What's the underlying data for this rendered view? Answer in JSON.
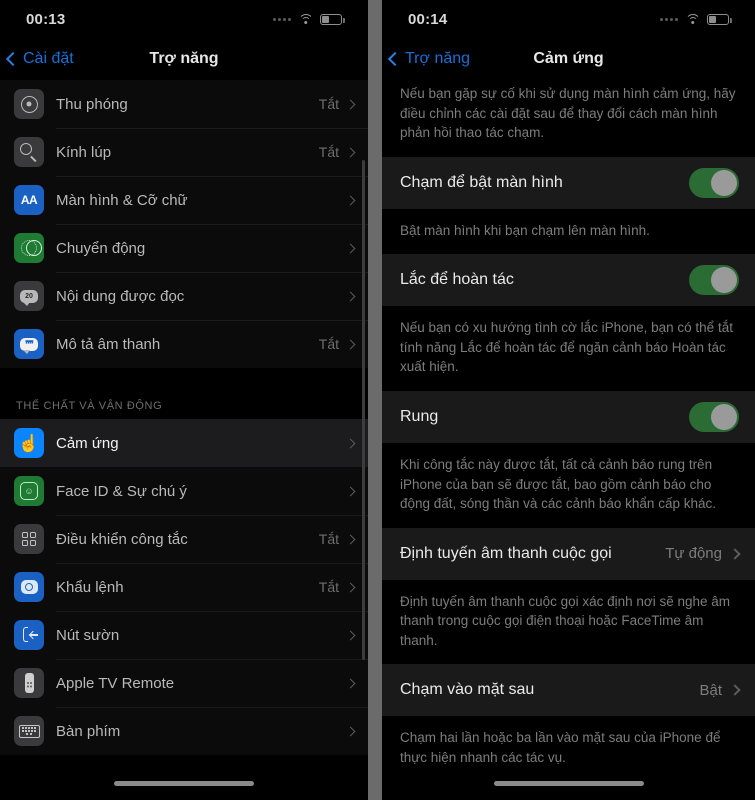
{
  "left_screen": {
    "status_bar": {
      "time": "00:13",
      "signal_icon": "signal-dots-icon",
      "wifi_icon": "wifi-icon",
      "battery_icon": "battery-icon"
    },
    "nav": {
      "back_label": "Cài đặt",
      "title": "Trợ năng",
      "back_icon": "chevron-left-icon"
    },
    "items": [
      {
        "label": "Thu phóng",
        "value": "Tắt",
        "icon": "zoom-icon",
        "icon_color": "#3a3a3c",
        "selected": false
      },
      {
        "label": "Kính lúp",
        "value": "Tắt",
        "icon": "magnifier-icon",
        "icon_color": "#3a3a3c",
        "selected": false
      },
      {
        "label": "Màn hình & Cỡ chữ",
        "value": "",
        "icon": "text-size-icon",
        "icon_color": "#1b61c4",
        "selected": false
      },
      {
        "label": "Chuyển động",
        "value": "",
        "icon": "motion-icon",
        "icon_color": "#1f7a34",
        "selected": false
      },
      {
        "label": "Nội dung được đọc",
        "value": "",
        "icon": "spoken-content-icon",
        "icon_color": "#3a3a3c",
        "selected": false
      },
      {
        "label": "Mô tả âm thanh",
        "value": "Tắt",
        "icon": "audio-description-icon",
        "icon_color": "#1b61c4",
        "selected": false
      }
    ],
    "section_header": "THỂ CHẤT VÀ VẬN ĐỘNG",
    "items2": [
      {
        "label": "Cảm ứng",
        "value": "",
        "icon": "touch-hand-icon",
        "icon_color": "#0a84ff",
        "selected": true
      },
      {
        "label": "Face ID & Sự chú ý",
        "value": "",
        "icon": "face-id-icon",
        "icon_color": "#1f7a34",
        "selected": false
      },
      {
        "label": "Điều khiển công tắc",
        "value": "Tắt",
        "icon": "switch-control-icon",
        "icon_color": "#3a3a3c",
        "selected": false
      },
      {
        "label": "Khẩu lệnh",
        "value": "Tắt",
        "icon": "voice-control-icon",
        "icon_color": "#1b61c4",
        "selected": false
      },
      {
        "label": "Nút sườn",
        "value": "",
        "icon": "side-button-icon",
        "icon_color": "#1b61c4",
        "selected": false
      },
      {
        "label": "Apple TV Remote",
        "value": "",
        "icon": "apple-tv-remote-icon",
        "icon_color": "#3a3a3c",
        "selected": false
      },
      {
        "label": "Bàn phím",
        "value": "",
        "icon": "keyboard-icon",
        "icon_color": "#3a3a3c",
        "selected": false
      }
    ]
  },
  "right_screen": {
    "status_bar": {
      "time": "00:14",
      "signal_icon": "signal-dots-icon",
      "wifi_icon": "wifi-icon",
      "battery_icon": "battery-icon"
    },
    "nav": {
      "back_label": "Trợ năng",
      "title": "Cảm ứng",
      "back_icon": "chevron-left-icon"
    },
    "intro_text": "Nếu bạn gặp sự cố khi sử dụng màn hình cảm ứng, hãy điều chỉnh các cài đặt sau để thay đổi cách màn hình phản hồi thao tác chạm.",
    "rows": [
      {
        "title": "Chạm để bật màn hình",
        "control": "toggle",
        "toggle_on": true,
        "footnote": "Bật màn hình khi bạn chạm lên màn hình."
      },
      {
        "title": "Lắc để hoàn tác",
        "control": "toggle",
        "toggle_on": true,
        "footnote": "Nếu bạn có xu hướng tình cờ lắc iPhone, bạn có thể tắt tính năng Lắc để hoàn tác để ngăn cảnh báo Hoàn tác xuất hiện."
      },
      {
        "title": "Rung",
        "control": "toggle",
        "toggle_on": true,
        "footnote": "Khi công tắc này được tắt, tất cả cảnh báo rung trên iPhone của bạn sẽ được tắt, bao gồm cảnh báo cho động đất, sóng thần và các cảnh báo khẩn cấp khác."
      },
      {
        "title": "Định tuyến âm thanh cuộc gọi",
        "control": "value",
        "value": "Tự động",
        "footnote": "Định tuyến âm thanh cuộc gọi xác định nơi sẽ nghe âm thanh trong cuộc gọi điện thoại hoặc FaceTime âm thanh."
      },
      {
        "title": "Chạm vào mặt sau",
        "control": "value",
        "value": "Bật",
        "footnote": "Chạm hai lần hoặc ba lần vào mặt sau của iPhone để thực hiện nhanh các tác vụ."
      }
    ]
  },
  "colors": {
    "accent_blue": "#0a84ff",
    "toggle_on": "#2b6b34",
    "cell_bg": "#1a1a1a",
    "selected_row": "#1c1c1e"
  }
}
